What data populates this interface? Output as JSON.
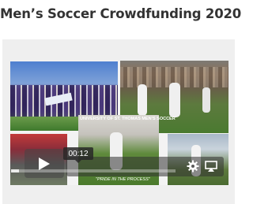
{
  "page": {
    "title": "Men’s Soccer Crowdfunding 2020"
  },
  "video": {
    "caption_top": "UNIVERSITY OF ST. THOMAS MEN'S SOCCER",
    "caption_bottom": "\"PRIDE IN THE PROCESS\"",
    "timecode": "00:12",
    "progress": 0.05
  },
  "icons": {
    "play": "play-icon",
    "settings": "gear-icon",
    "airplay": "airplay-icon"
  }
}
